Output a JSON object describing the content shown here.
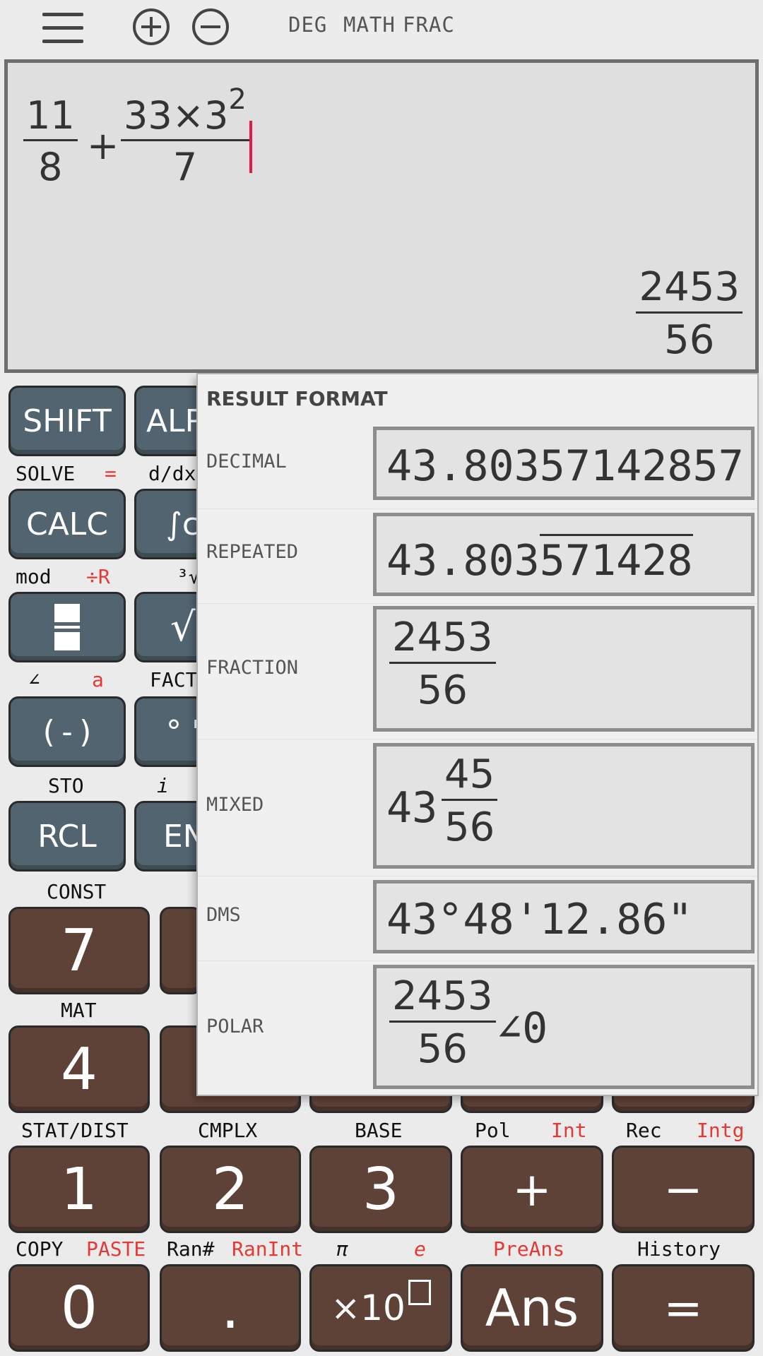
{
  "header": {
    "zoom_in_icon": "plus-circle-icon",
    "zoom_out_icon": "minus-circle-icon",
    "mode_deg": "DEG",
    "mode_math": "MATH",
    "mode_frac": "FRAC"
  },
  "expression": {
    "term1_num": "11",
    "term1_den": "8",
    "operator": "+",
    "term2_num_base": "33×3",
    "term2_num_exp": "2",
    "term2_den": "7"
  },
  "result": {
    "numerator": "2453",
    "denominator": "56"
  },
  "result_format": {
    "title": "RESULT FORMAT",
    "rows": [
      {
        "label": "DECIMAL",
        "value": "43.80357142857"
      },
      {
        "label": "REPEATED",
        "value_prefix": "43.803",
        "value_repeating": "571428"
      },
      {
        "label": "FRACTION",
        "numerator": "2453",
        "denominator": "56"
      },
      {
        "label": "MIXED",
        "whole": "43",
        "numerator": "45",
        "denominator": "56"
      },
      {
        "label": "DMS",
        "value": "43°48'12.86\""
      },
      {
        "label": "POLAR",
        "numerator": "2453",
        "denominator": "56",
        "angle": "∠0"
      }
    ]
  },
  "keypad": {
    "shift": "SHIFT",
    "alpha": "ALP",
    "calc": "CALC",
    "integral": "∫c",
    "frac_key_icon": "fraction-icon",
    "sqrt": "√",
    "neg": "(-)",
    "deg_key": "° '",
    "rcl": "RCL",
    "eng": "EN",
    "solve": "SOLVE",
    "equals_sub": "=",
    "ddx": "d/dx",
    "mod": "mod",
    "divR": "÷R",
    "cbrt": "³√",
    "angle": "∠",
    "a": "a",
    "fact": "FACT",
    "sto": "STO",
    "i": "i",
    "const": "CONST",
    "d7": "7",
    "mat": "MAT",
    "d4": "4",
    "stat": "STAT/DIST",
    "cmplx": "CMPLX",
    "base": "BASE",
    "pol": "Pol",
    "int": "Int",
    "rec": "Rec",
    "intg": "Intg",
    "d1": "1",
    "d2": "2",
    "d3": "3",
    "plus": "+",
    "minus": "−",
    "copy": "COPY",
    "paste": "PASTE",
    "ran": "Ran#",
    "ranint": "RanInt",
    "pi": "π",
    "e": "e",
    "preans": "PreAns",
    "history": "History",
    "d0": "0",
    "dot": ".",
    "x10": "×10",
    "ans": "Ans",
    "equals": "="
  }
}
